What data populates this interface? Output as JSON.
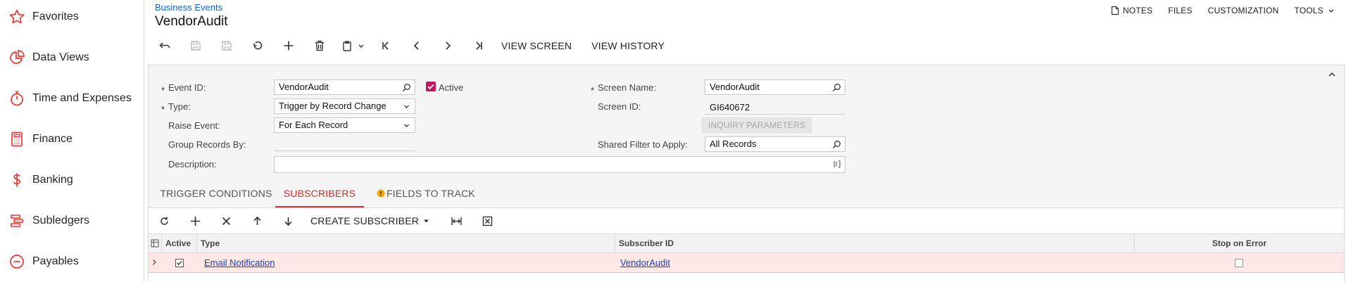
{
  "sidebar": {
    "items": [
      {
        "label": "Favorites",
        "icon": "star-icon"
      },
      {
        "label": "Data Views",
        "icon": "pie-chart-icon"
      },
      {
        "label": "Time and Expenses",
        "icon": "stopwatch-icon"
      },
      {
        "label": "Finance",
        "icon": "calculator-icon"
      },
      {
        "label": "Banking",
        "icon": "dollar-icon"
      },
      {
        "label": "Subledgers",
        "icon": "ledger-icon"
      },
      {
        "label": "Payables",
        "icon": "minus-circle-icon"
      }
    ]
  },
  "header": {
    "breadcrumb": "Business Events",
    "title": "VendorAudit",
    "links": {
      "notes": "NOTES",
      "files": "FILES",
      "customization": "CUSTOMIZATION",
      "tools": "TOOLS"
    }
  },
  "toolbar": {
    "view_screen": "VIEW SCREEN",
    "view_history": "VIEW HISTORY"
  },
  "form": {
    "event_id_label": "Event ID:",
    "event_id_value": "VendorAudit",
    "active_label": "Active",
    "type_label": "Type:",
    "type_value": "Trigger by Record Change",
    "raise_event_label": "Raise Event:",
    "raise_event_value": "For Each Record",
    "group_records_label": "Group Records By:",
    "description_label": "Description:",
    "screen_name_label": "Screen Name:",
    "screen_name_value": "VendorAudit",
    "screen_id_label": "Screen ID:",
    "screen_id_value": "GI640672",
    "inquiry_parameters": "INQUIRY PARAMETERS",
    "shared_filter_label": "Shared Filter to Apply:",
    "shared_filter_value": "All Records",
    "required_mark": "*"
  },
  "tabs": [
    {
      "label": "TRIGGER CONDITIONS"
    },
    {
      "label": "SUBSCRIBERS"
    },
    {
      "label": "FIELDS TO TRACK"
    }
  ],
  "grid_toolbar": {
    "create_subscriber": "CREATE SUBSCRIBER"
  },
  "grid": {
    "columns": [
      "Active",
      "Type",
      "Subscriber ID",
      "Stop on Error"
    ],
    "rows": [
      {
        "active": true,
        "type": "Email Notification",
        "subscriber_id": "VendorAudit",
        "stop_on_error": false
      }
    ]
  },
  "colors": {
    "accent": "#d32f2f",
    "checkbox_active": "#c2185b",
    "link": "#1565c0",
    "row_highlight": "#fde7e7"
  }
}
